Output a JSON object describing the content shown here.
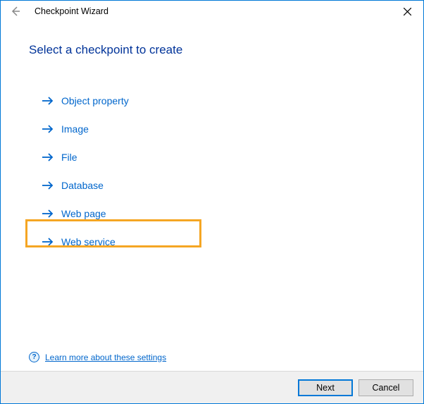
{
  "window": {
    "title": "Checkpoint Wizard"
  },
  "heading": "Select a checkpoint to create",
  "options": [
    {
      "label": "Object property"
    },
    {
      "label": "Image"
    },
    {
      "label": "File"
    },
    {
      "label": "Database"
    },
    {
      "label": "Web page"
    },
    {
      "label": "Web service"
    }
  ],
  "highlighted_index": 4,
  "help": {
    "link_text": "Learn more about these settings"
  },
  "buttons": {
    "next": "Next",
    "cancel": "Cancel"
  }
}
